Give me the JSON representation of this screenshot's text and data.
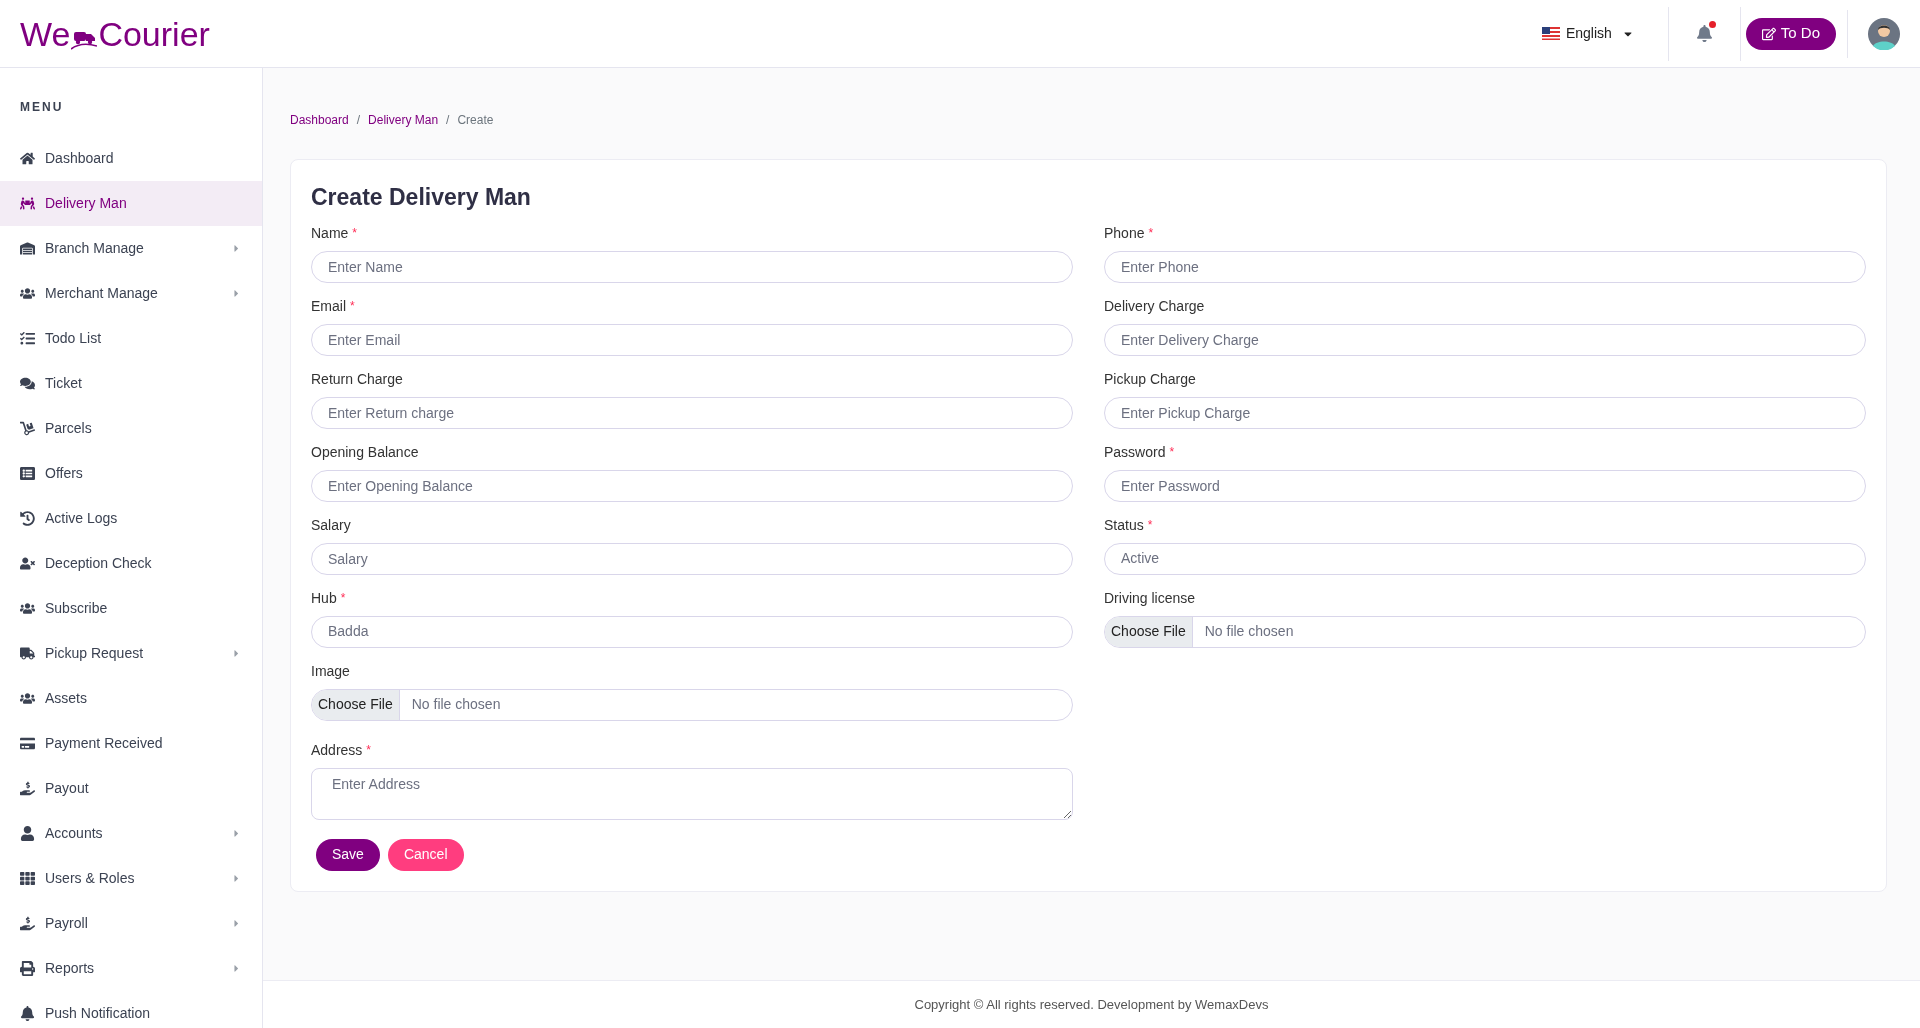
{
  "logo": {
    "left": "We",
    "right": "Courier"
  },
  "header": {
    "language": "English",
    "todo": "To Do",
    "notification_dot": true
  },
  "sidebar": {
    "heading": "MENU",
    "items": [
      {
        "label": "Dashboard",
        "selected": false,
        "submenu": false
      },
      {
        "label": "Delivery Man",
        "selected": true,
        "submenu": false
      },
      {
        "label": "Branch Manage",
        "selected": false,
        "submenu": true
      },
      {
        "label": "Merchant Manage",
        "selected": false,
        "submenu": true
      },
      {
        "label": "Todo List",
        "selected": false,
        "submenu": false
      },
      {
        "label": "Ticket",
        "selected": false,
        "submenu": false
      },
      {
        "label": "Parcels",
        "selected": false,
        "submenu": false
      },
      {
        "label": "Offers",
        "selected": false,
        "submenu": false
      },
      {
        "label": "Active Logs",
        "selected": false,
        "submenu": false
      },
      {
        "label": "Deception Check",
        "selected": false,
        "submenu": false
      },
      {
        "label": "Subscribe",
        "selected": false,
        "submenu": false
      },
      {
        "label": "Pickup Request",
        "selected": false,
        "submenu": true
      },
      {
        "label": "Assets",
        "selected": false,
        "submenu": false
      },
      {
        "label": "Payment Received",
        "selected": false,
        "submenu": false
      },
      {
        "label": "Payout",
        "selected": false,
        "submenu": false
      },
      {
        "label": "Accounts",
        "selected": false,
        "submenu": true
      },
      {
        "label": "Users & Roles",
        "selected": false,
        "submenu": true
      },
      {
        "label": "Payroll",
        "selected": false,
        "submenu": true
      },
      {
        "label": "Reports",
        "selected": false,
        "submenu": true
      },
      {
        "label": "Push Notification",
        "selected": false,
        "submenu": false
      }
    ]
  },
  "breadcrumb": {
    "separator": "/",
    "items": [
      {
        "label": "Dashboard",
        "link": true
      },
      {
        "label": "Delivery Man",
        "link": true
      },
      {
        "label": "Create",
        "link": false
      }
    ]
  },
  "form": {
    "title": "Create Delivery Man",
    "left_fields": [
      {
        "kind": "text",
        "label": "Name",
        "required_mark": "*",
        "placeholder": "Enter Name"
      },
      {
        "kind": "text",
        "label": "Email",
        "required_mark": "*",
        "placeholder": "Enter Email"
      },
      {
        "kind": "text",
        "label": "Return Charge",
        "placeholder": "Enter Return charge"
      },
      {
        "kind": "text",
        "label": "Opening Balance",
        "placeholder": "Enter Opening Balance"
      },
      {
        "kind": "text",
        "label": "Salary",
        "placeholder": "Salary"
      },
      {
        "kind": "select",
        "label": "Hub",
        "required_mark": "*",
        "value": "Badda"
      },
      {
        "kind": "file",
        "label": "Image",
        "button": "Choose File",
        "value": "No file chosen"
      },
      {
        "kind": "textarea",
        "label": "Address",
        "required_mark": "*",
        "placeholder": "Enter Address"
      }
    ],
    "right_fields": [
      {
        "kind": "text",
        "label": "Phone",
        "required_mark": "*",
        "placeholder": "Enter Phone"
      },
      {
        "kind": "text",
        "label": "Delivery Charge",
        "placeholder": "Enter Delivery Charge"
      },
      {
        "kind": "text",
        "label": "Pickup Charge",
        "placeholder": "Enter Pickup Charge"
      },
      {
        "kind": "text",
        "label": "Password",
        "required_mark": "*",
        "placeholder": "Enter Password"
      },
      {
        "kind": "select",
        "label": "Status",
        "required_mark": "*",
        "value": "Active"
      },
      {
        "kind": "file",
        "label": "Driving license",
        "button": "Choose File",
        "value": "No file chosen"
      }
    ],
    "buttons": [
      {
        "kind": "primary",
        "label": "Save"
      },
      {
        "kind": "danger",
        "label": "Cancel"
      }
    ]
  },
  "footer": "Copyright © All rights reserved. Development by WemaxDevs"
}
